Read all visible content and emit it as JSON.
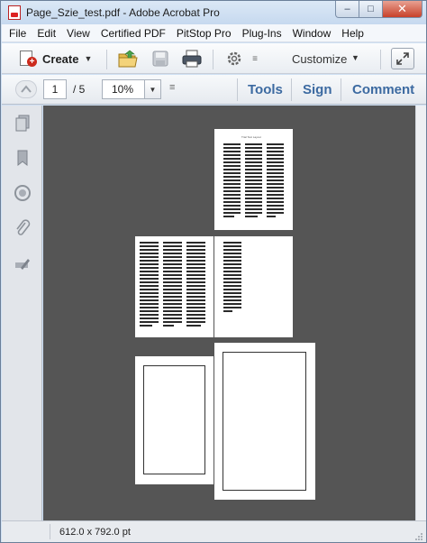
{
  "window": {
    "title": "Page_Szie_test.pdf - Adobe Acrobat Pro",
    "controls": {
      "minimize": "–",
      "maximize": "□",
      "close": "✕"
    }
  },
  "menu": [
    "File",
    "Edit",
    "View",
    "Certified PDF",
    "PitStop Pro",
    "Plug-Ins",
    "Window",
    "Help"
  ],
  "toolbar": {
    "create_label": "Create",
    "customize_label": "Customize",
    "icons": [
      "create-pdf-icon",
      "open-folder-icon",
      "save-icon",
      "print-icon",
      "settings-gear-icon",
      "expand-icon"
    ]
  },
  "navigation": {
    "current_page": "1",
    "page_of": "/ 5",
    "zoom": "10%"
  },
  "panels": {
    "tools": "Tools",
    "sign": "Sign",
    "comment": "Comment"
  },
  "left_nav_icons": [
    "page-thumbnails-icon",
    "bookmarks-icon",
    "signatures-icon",
    "attachments-icon",
    "content-edit-icon"
  ],
  "document": {
    "page1_heading": "Trial Text Layout"
  },
  "status": {
    "page_size": "612.0 x 792.0 pt"
  }
}
